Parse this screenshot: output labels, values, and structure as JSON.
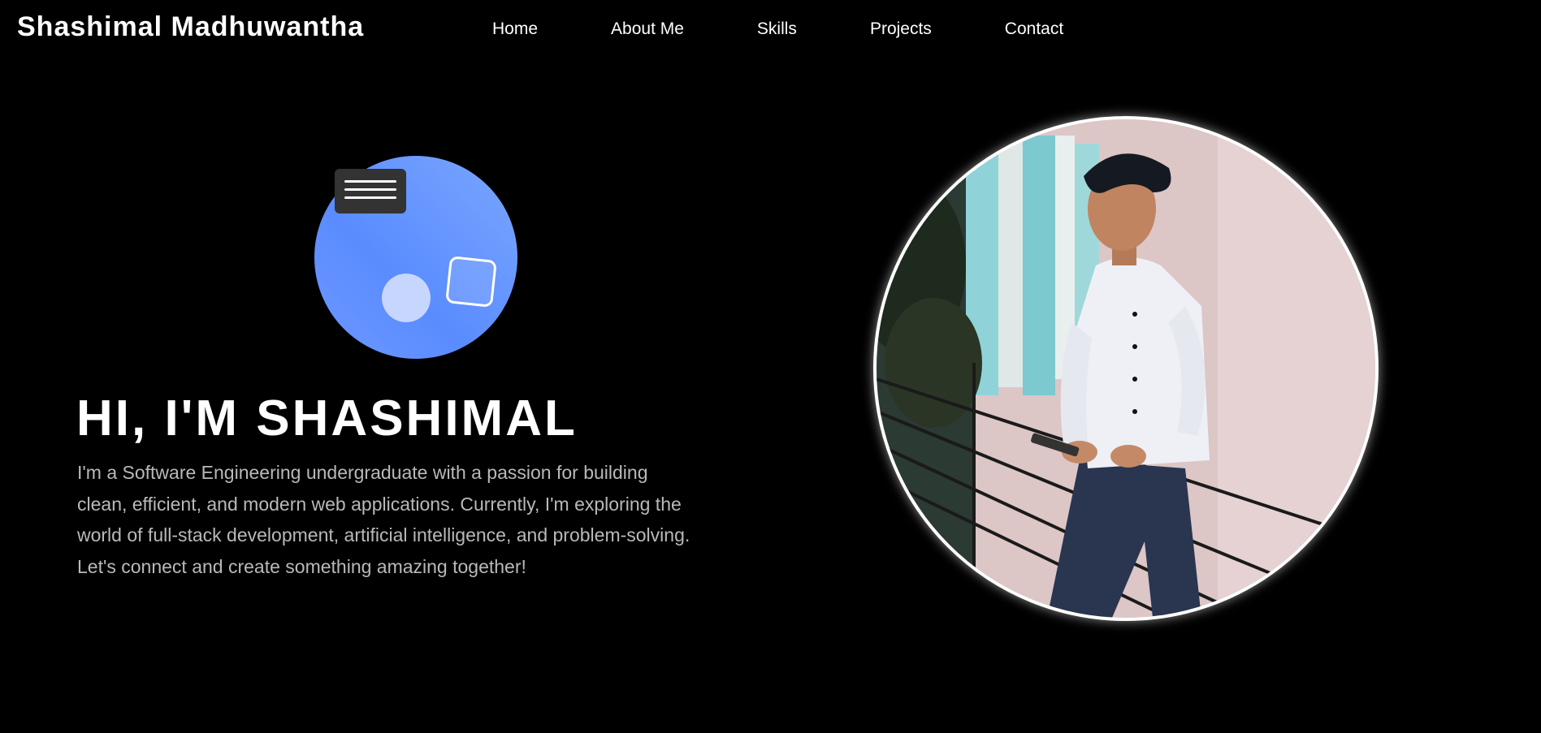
{
  "brand": {
    "name": "Shashimal Madhuwantha"
  },
  "nav": {
    "links": [
      {
        "label": "Home"
      },
      {
        "label": "About Me"
      },
      {
        "label": "Skills"
      },
      {
        "label": "Projects"
      },
      {
        "label": "Contact"
      }
    ]
  },
  "hero": {
    "title": "HI, I'M SHASHIMAL",
    "text": "I'm a Software Engineering undergraduate with a passion for building clean, efficient, and modern web applications. Currently, I'm exploring the world of full-stack development, artificial intelligence, and problem-solving. Let's connect and create something amazing together!"
  },
  "illustration": {
    "icons": [
      "menu-icon",
      "circle-shape",
      "square-shape"
    ],
    "colors": {
      "circle_bg": "#6a95ff",
      "menu_box": "#333333",
      "small_circle": "#c6d6ff"
    }
  },
  "profile_photo": {
    "border_color": "#ffffff"
  },
  "colors": {
    "background": "#000000",
    "text": "#ffffff",
    "muted_text": "#b9b9b9"
  }
}
